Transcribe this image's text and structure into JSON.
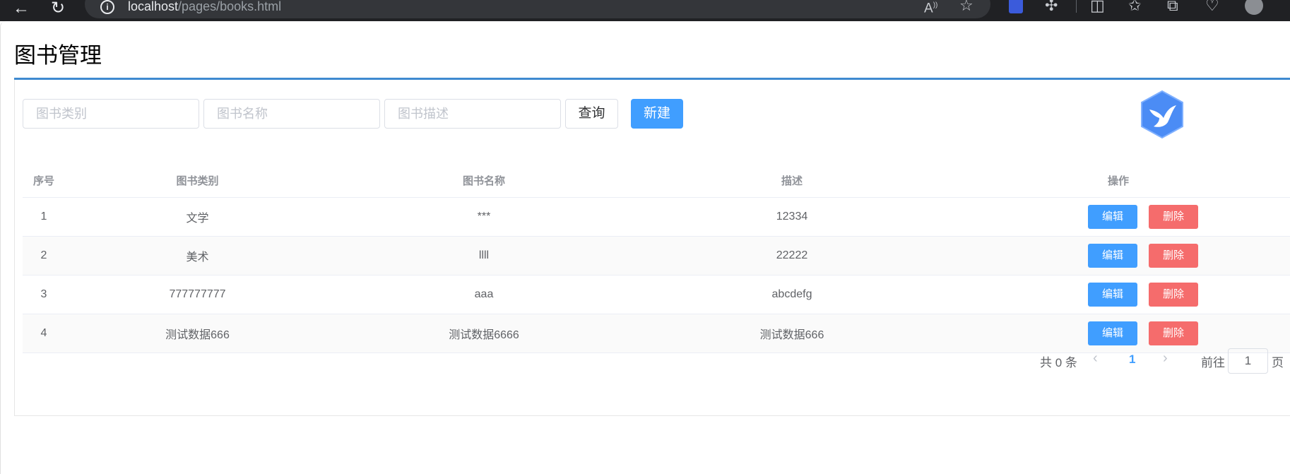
{
  "browser": {
    "url_host": "localhost",
    "url_path": "/pages/books.html"
  },
  "page": {
    "title": "图书管理"
  },
  "search": {
    "category_placeholder": "图书类别",
    "name_placeholder": "图书名称",
    "desc_placeholder": "图书描述",
    "query_label": "查询",
    "new_label": "新建"
  },
  "table": {
    "headers": [
      "序号",
      "图书类别",
      "图书名称",
      "描述",
      "操作"
    ],
    "rows": [
      {
        "idx": "1",
        "category": "文学",
        "name": "***",
        "desc": "12334"
      },
      {
        "idx": "2",
        "category": "美术",
        "name": "llll",
        "desc": "22222"
      },
      {
        "idx": "3",
        "category": "777777777",
        "name": "aaa",
        "desc": "abcdefg"
      },
      {
        "idx": "4",
        "category": "测试数据666",
        "name": "测试数据6666",
        "desc": "测试数据666"
      }
    ],
    "edit_label": "编辑",
    "delete_label": "删除"
  },
  "pagination": {
    "total_text": "共 0 条",
    "current_page": "1",
    "goto_label": "前往",
    "goto_value": "1",
    "page_suffix": "页"
  },
  "colors": {
    "primary": "#409eff",
    "danger": "#f56c6c",
    "title_underline": "#3f8ad0"
  }
}
